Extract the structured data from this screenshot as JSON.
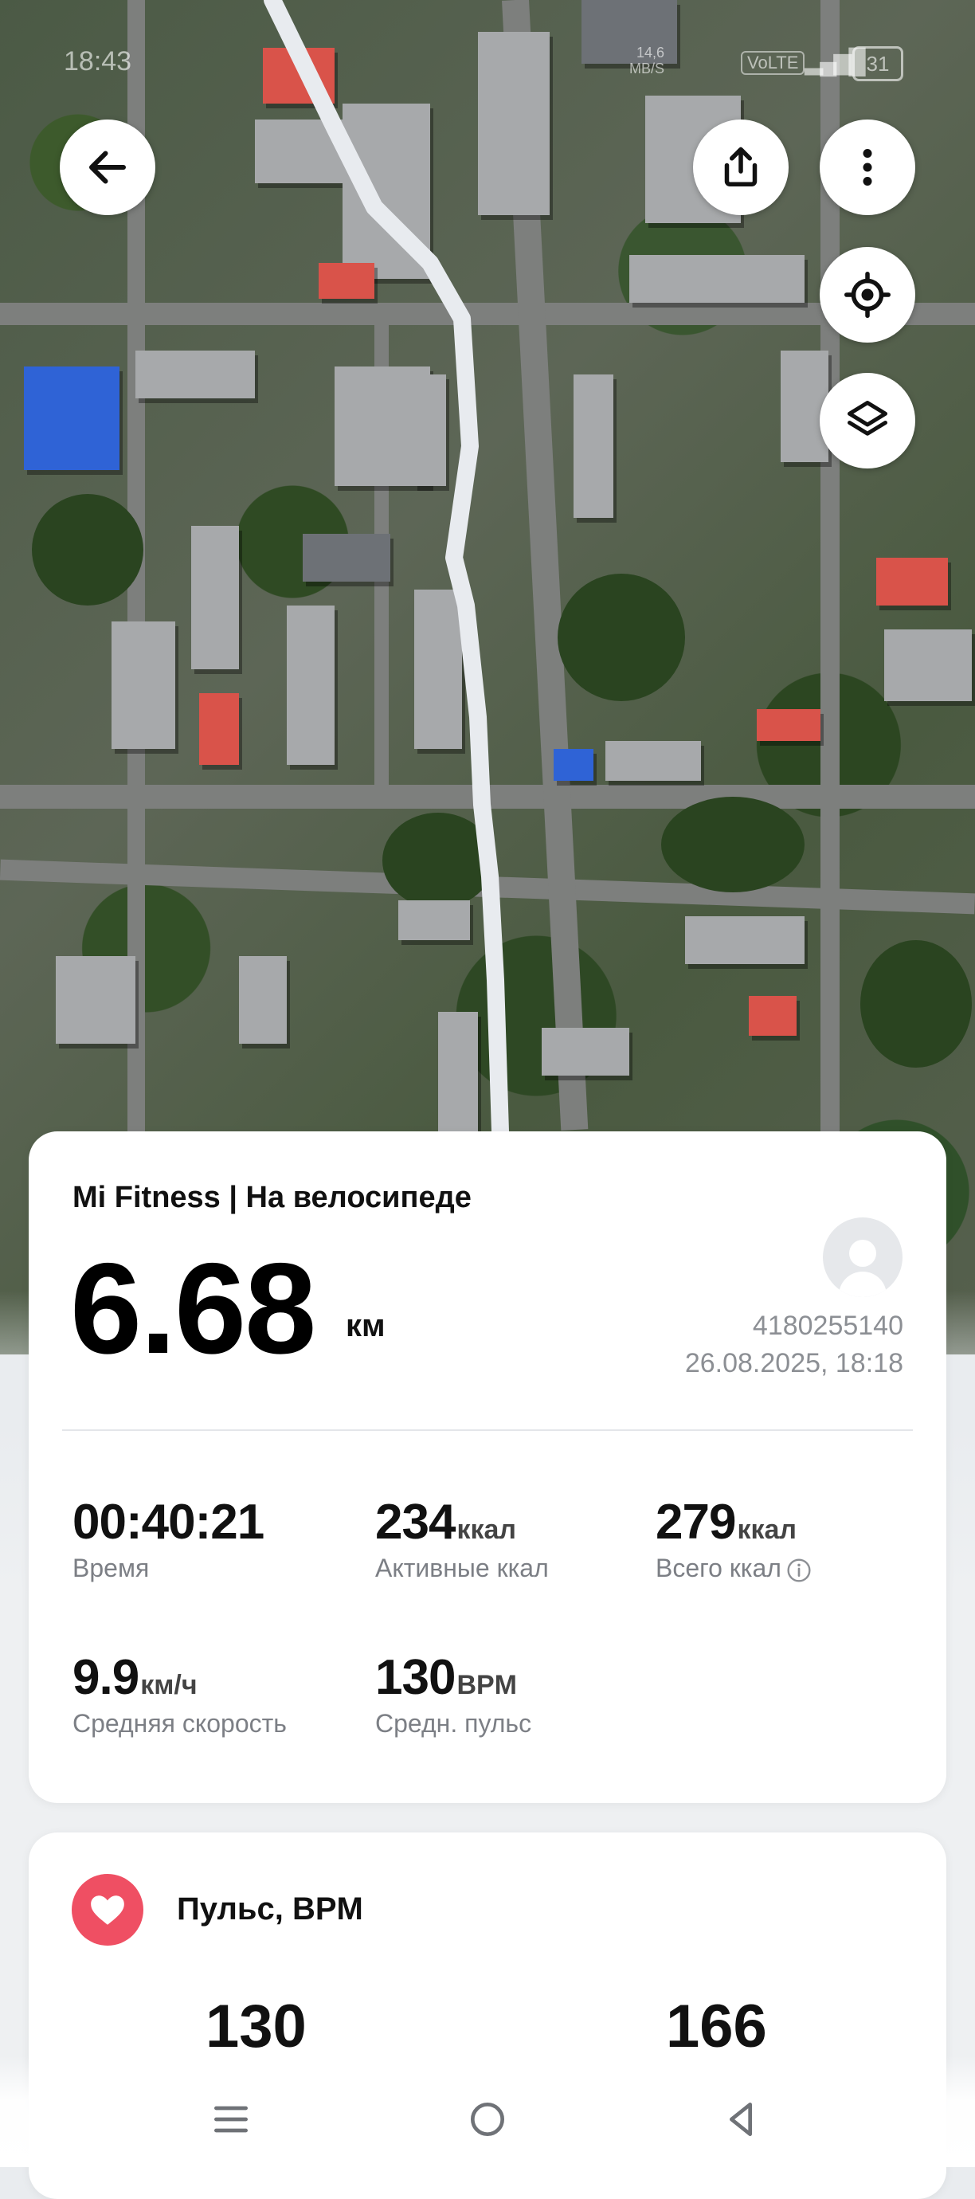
{
  "statusbar": {
    "time": "18:43",
    "net_speed": "14,6\nMB/S",
    "volte": "VoLTE",
    "battery": "31"
  },
  "map": {
    "back_icon": "arrow-left-icon",
    "share_icon": "share-icon",
    "more_icon": "more-vertical-icon",
    "locate_icon": "locate-target-icon",
    "layers_icon": "layers-icon"
  },
  "summary": {
    "app_title": "Mi Fitness | На велосипеде",
    "distance": "6.68",
    "distance_unit": "км",
    "user_id": "4180255140",
    "datetime": "26.08.2025, 18:18",
    "stats": {
      "time": {
        "value": "00:40:21",
        "unit": "",
        "label": "Время"
      },
      "active_kcal": {
        "value": "234",
        "unit": "ккал",
        "label": "Активные ккал"
      },
      "total_kcal": {
        "value": "279",
        "unit": "ккал",
        "label": "Всего ккал"
      },
      "avg_speed": {
        "value": "9.9",
        "unit": "км/ч",
        "label": "Средняя скорость"
      },
      "avg_pulse": {
        "value": "130",
        "unit": "BPM",
        "label": "Средн. пульс"
      }
    }
  },
  "pulse": {
    "title": "Пульс, BPM",
    "avg_value": "130",
    "max_value": "166",
    "accent": "#ef4f63"
  },
  "navbar": {
    "menu_icon": "menu-icon",
    "home_icon": "home-circle-icon",
    "back_icon": "back-triangle-icon"
  }
}
